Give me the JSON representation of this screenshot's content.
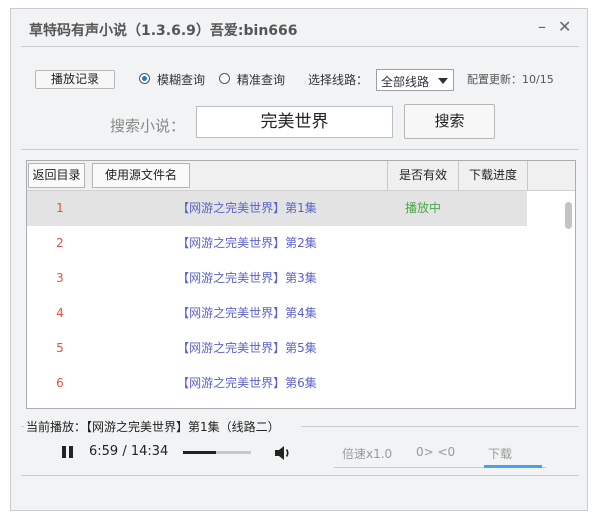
{
  "window": {
    "title": "草特码有声小说（1.3.6.9）吾爱:bin666",
    "min_glyph": "–",
    "close_glyph": "✕"
  },
  "toolbar": {
    "history_button": "播放记录",
    "radio_fuzzy": "模糊查询",
    "radio_exact": "精准查询",
    "radio_selected": "fuzzy",
    "route_label": "选择线路：",
    "route_value": "全部线路",
    "config_label": "配置更新：10/15"
  },
  "search": {
    "label": "搜索小说：",
    "value": "完美世界",
    "button": "搜索"
  },
  "table": {
    "back_button": "返回目录",
    "source_button": "使用源文件名",
    "col_valid": "是否有效",
    "col_progress": "下载进度",
    "rows": [
      {
        "num": "1",
        "name": "【网游之完美世界】第1集",
        "valid": "播放中"
      },
      {
        "num": "2",
        "name": "【网游之完美世界】第2集",
        "valid": ""
      },
      {
        "num": "3",
        "name": "【网游之完美世界】第3集",
        "valid": ""
      },
      {
        "num": "4",
        "name": "【网游之完美世界】第4集",
        "valid": ""
      },
      {
        "num": "5",
        "name": "【网游之完美世界】第5集",
        "valid": ""
      },
      {
        "num": "6",
        "name": "【网游之完美世界】第6集",
        "valid": ""
      }
    ]
  },
  "player": {
    "now_playing": "当前播放：【网游之完美世界】第1集（线路二）",
    "time": "6:59 / 14:34",
    "progress": 0.48,
    "speed": "倍速x1.0",
    "skip": "0> <0",
    "download": "下载"
  },
  "colors": {
    "row_num": "#e0524a",
    "row_name": "#5b62c9",
    "valid_text": "#4aa84a",
    "accent": "#4aa3e8"
  }
}
